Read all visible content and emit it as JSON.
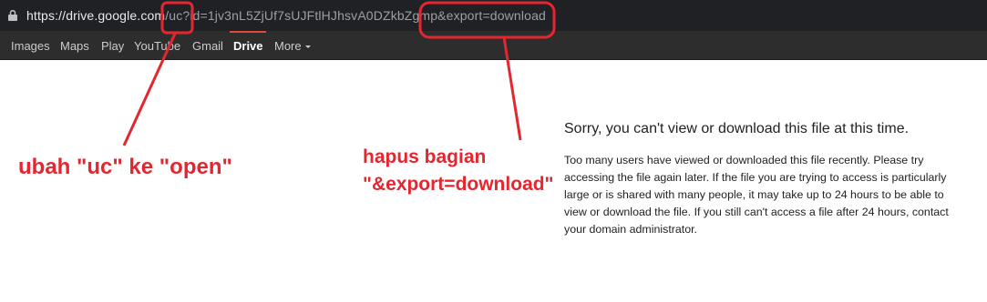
{
  "address_bar": {
    "host": "https://drive.google.com",
    "rest": "/uc?id=1jv3nL5ZjUf7sUJFtlHJhsvA0DZkbZgmp&export=download"
  },
  "gbar": {
    "items": [
      "Images",
      "Maps",
      "Play",
      "YouTube",
      "Gmail",
      "Drive",
      "More"
    ],
    "active": "Drive"
  },
  "error": {
    "title": "Sorry, you can't view or download this file at this time.",
    "body": "Too many users have viewed or downloaded this file recently. Please try accessing the file again later. If the file you are trying to access is particularly large or is shared with many people, it may take up to 24 hours to be able to view or download the file. If you still can't access a file after 24 hours, contact your domain administrator."
  },
  "annotations": {
    "note1": "ubah \"uc\" ke \"open\"",
    "note2_line1": "hapus bagian",
    "note2_line2": "\"&export=download\""
  },
  "colors": {
    "annotation": "#e3262f",
    "active_tab_underline": "#dd4b39",
    "address_bar_bg": "#202124",
    "gbar_bg": "#2d2d2d"
  }
}
